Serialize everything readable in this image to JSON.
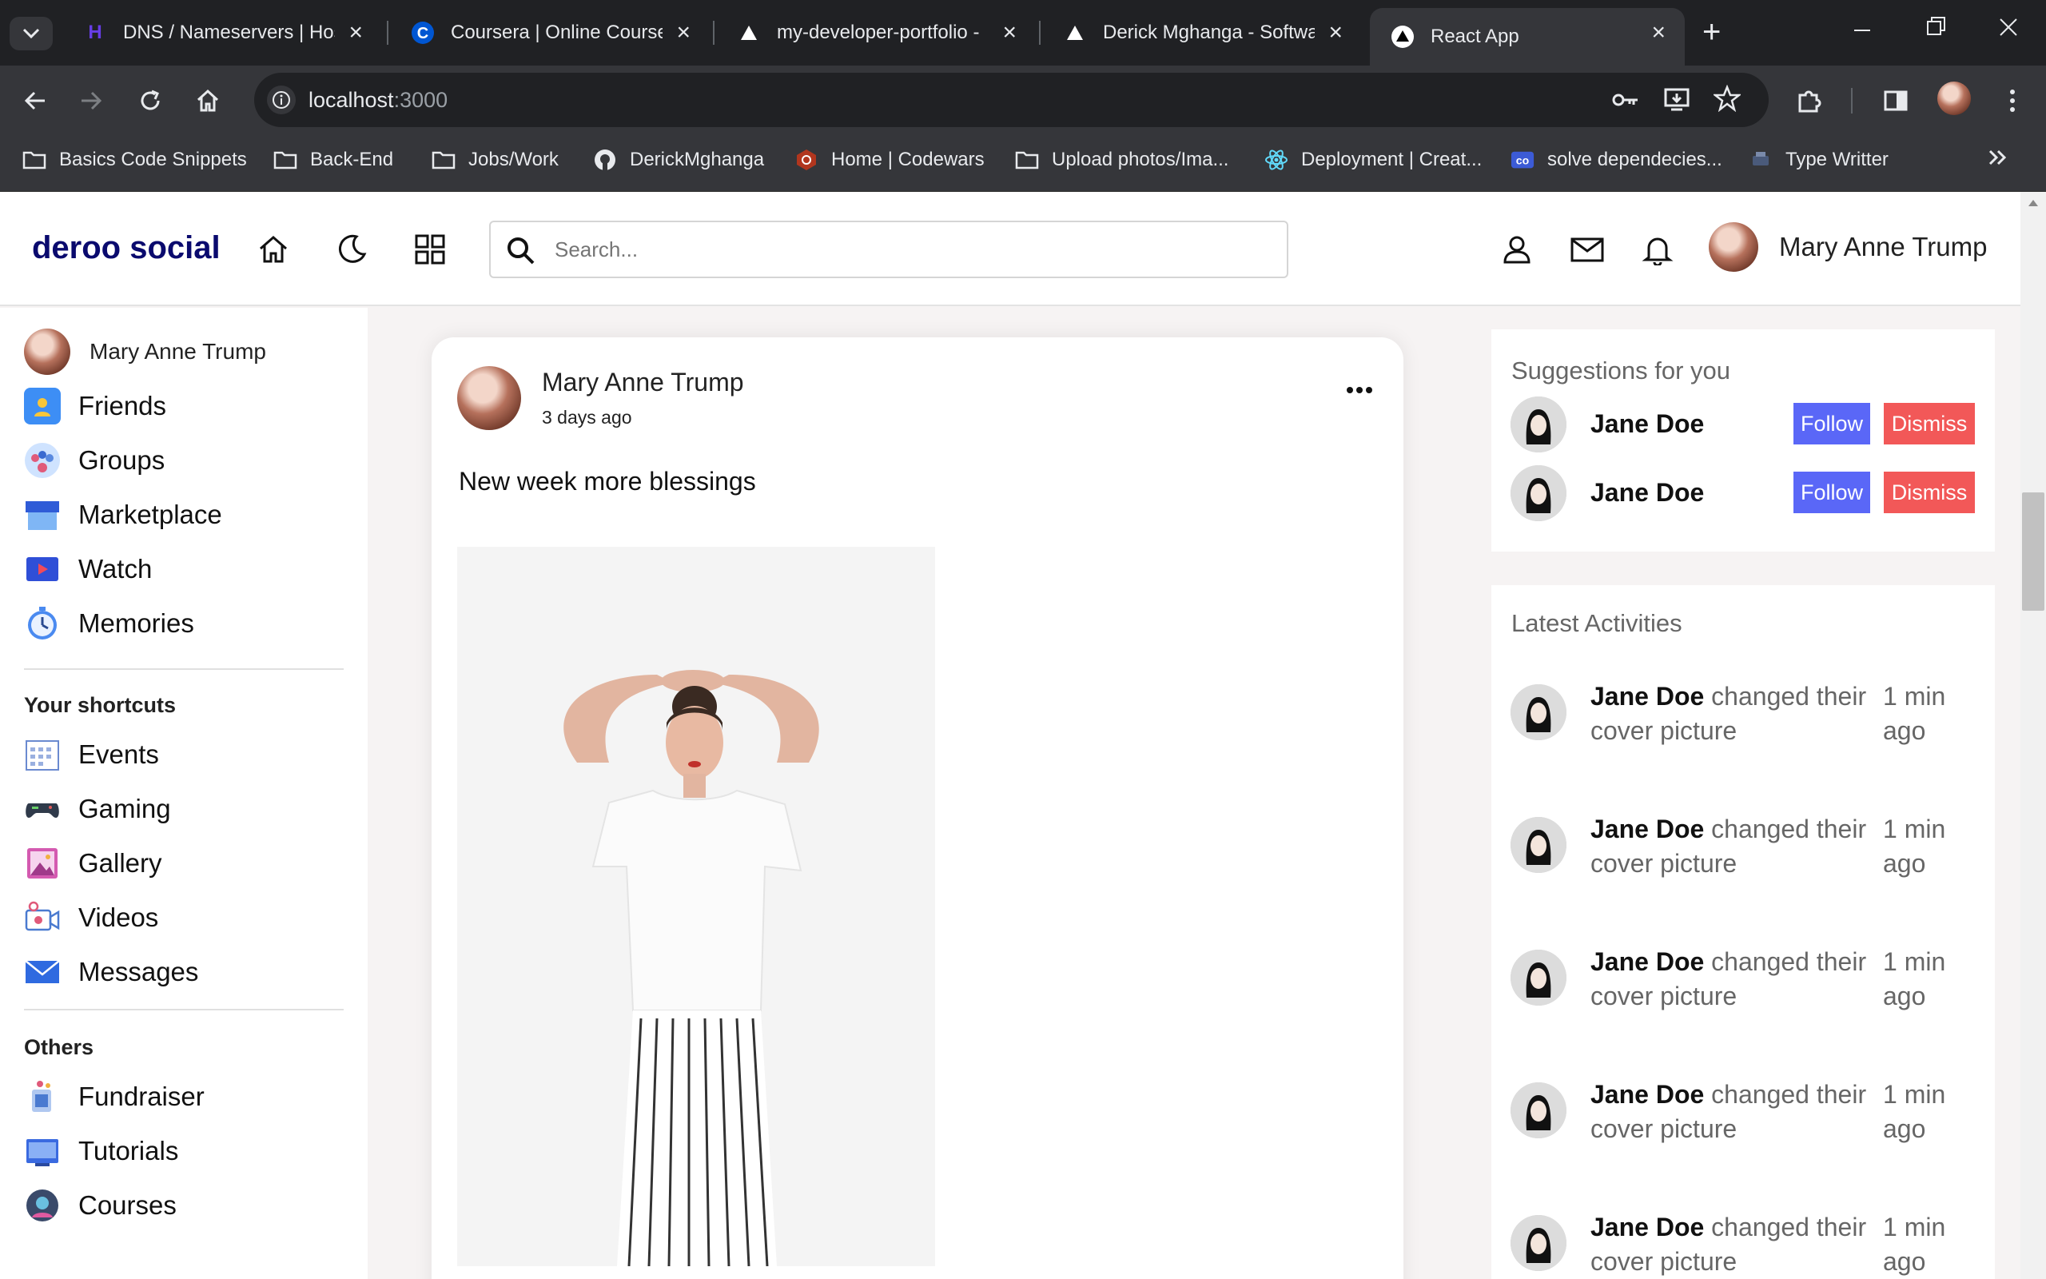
{
  "browser": {
    "tabs": [
      {
        "title": "DNS / Nameservers | Hos",
        "icon": "hostinger-icon",
        "active": false
      },
      {
        "title": "Coursera | Online Course",
        "icon": "coursera-icon",
        "active": false
      },
      {
        "title": "my-developer-portfolio -",
        "icon": "vercel-icon",
        "active": false
      },
      {
        "title": "Derick Mghanga - Softwa",
        "icon": "vercel-icon",
        "active": false
      },
      {
        "title": "React App",
        "icon": "vercel-icon",
        "active": true
      }
    ],
    "url_host": "localhost",
    "url_port": ":3000",
    "bookmarks": [
      {
        "label": "Basics Code Snippets",
        "icon": "folder-icon"
      },
      {
        "label": "Back-End",
        "icon": "folder-icon"
      },
      {
        "label": "Jobs/Work",
        "icon": "folder-icon"
      },
      {
        "label": "DerickMghanga",
        "icon": "github-icon"
      },
      {
        "label": "Home | Codewars",
        "icon": "codewars-icon"
      },
      {
        "label": "Upload photos/Ima...",
        "icon": "folder-icon"
      },
      {
        "label": "Deployment | Creat...",
        "icon": "react-icon"
      },
      {
        "label": "solve dependecies...",
        "icon": "codesandbox-icon"
      },
      {
        "label": "Type Writter",
        "icon": "typewriter-icon"
      }
    ]
  },
  "navbar": {
    "logo": "deroo social",
    "search_placeholder": "Search...",
    "user_name": "Mary Anne Trump"
  },
  "leftbar": {
    "user_name": "Mary Anne Trump",
    "menu": [
      {
        "label": "Friends",
        "icon": "friends-icon"
      },
      {
        "label": "Groups",
        "icon": "groups-icon"
      },
      {
        "label": "Marketplace",
        "icon": "marketplace-icon"
      },
      {
        "label": "Watch",
        "icon": "watch-icon"
      },
      {
        "label": "Memories",
        "icon": "memories-icon"
      }
    ],
    "shortcuts_title": "Your shortcuts",
    "shortcuts": [
      {
        "label": "Events",
        "icon": "events-icon"
      },
      {
        "label": "Gaming",
        "icon": "gaming-icon"
      },
      {
        "label": "Gallery",
        "icon": "gallery-icon"
      },
      {
        "label": "Videos",
        "icon": "videos-icon"
      },
      {
        "label": "Messages",
        "icon": "messages-icon"
      }
    ],
    "others_title": "Others",
    "others": [
      {
        "label": "Fundraiser",
        "icon": "fundraiser-icon"
      },
      {
        "label": "Tutorials",
        "icon": "tutorials-icon"
      },
      {
        "label": "Courses",
        "icon": "courses-icon"
      }
    ]
  },
  "post": {
    "author": "Mary Anne Trump",
    "time": "3 days ago",
    "text": "New week more blessings"
  },
  "suggestions": {
    "title": "Suggestions for you",
    "items": [
      {
        "name": "Jane Doe",
        "follow_label": "Follow",
        "dismiss_label": "Dismiss"
      },
      {
        "name": "Jane Doe",
        "follow_label": "Follow",
        "dismiss_label": "Dismiss"
      }
    ]
  },
  "activities": {
    "title": "Latest Activities",
    "items": [
      {
        "name": "Jane Doe",
        "action": "changed their cover picture",
        "time": "1 min ago"
      },
      {
        "name": "Jane Doe",
        "action": "changed their cover picture",
        "time": "1 min ago"
      },
      {
        "name": "Jane Doe",
        "action": "changed their cover picture",
        "time": "1 min ago"
      },
      {
        "name": "Jane Doe",
        "action": "changed their cover picture",
        "time": "1 min ago"
      },
      {
        "name": "Jane Doe",
        "action": "changed their cover picture",
        "time": "1 min ago"
      }
    ]
  },
  "colors": {
    "logo": "#0a0a6e",
    "follow_button": "#5a67f7",
    "dismiss_button": "#f25858",
    "chrome_dark": "#202124",
    "chrome_mid": "#35363a"
  }
}
